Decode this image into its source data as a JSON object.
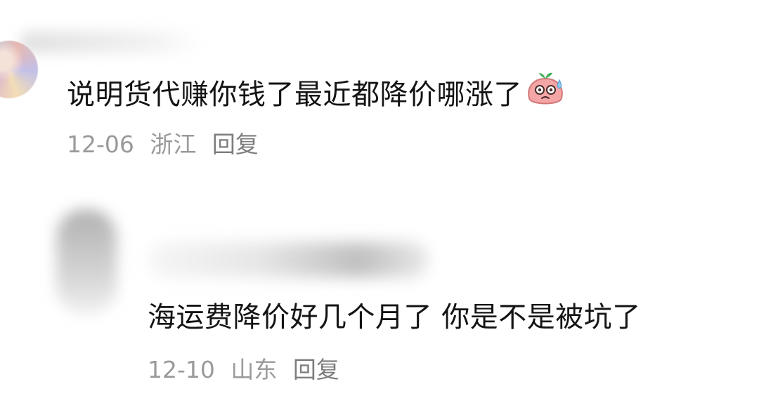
{
  "comments": [
    {
      "text": "说明货代赚你钱了最近都降价哪涨了",
      "emoji_icon": "sweating-face-emoji-icon",
      "date": "12-06",
      "location": "浙江",
      "reply_label": "回复"
    },
    {
      "text": "海运费降价好几个月了 你是不是被坑了",
      "date": "12-10",
      "location": "山东",
      "reply_label": "回复"
    }
  ],
  "colors": {
    "text_primary": "#141414",
    "text_meta": "#9a9a9a",
    "emoji_pink": "#f4a6a6",
    "emoji_green": "#3fae5a",
    "emoji_sweat": "#8ec9ef"
  }
}
